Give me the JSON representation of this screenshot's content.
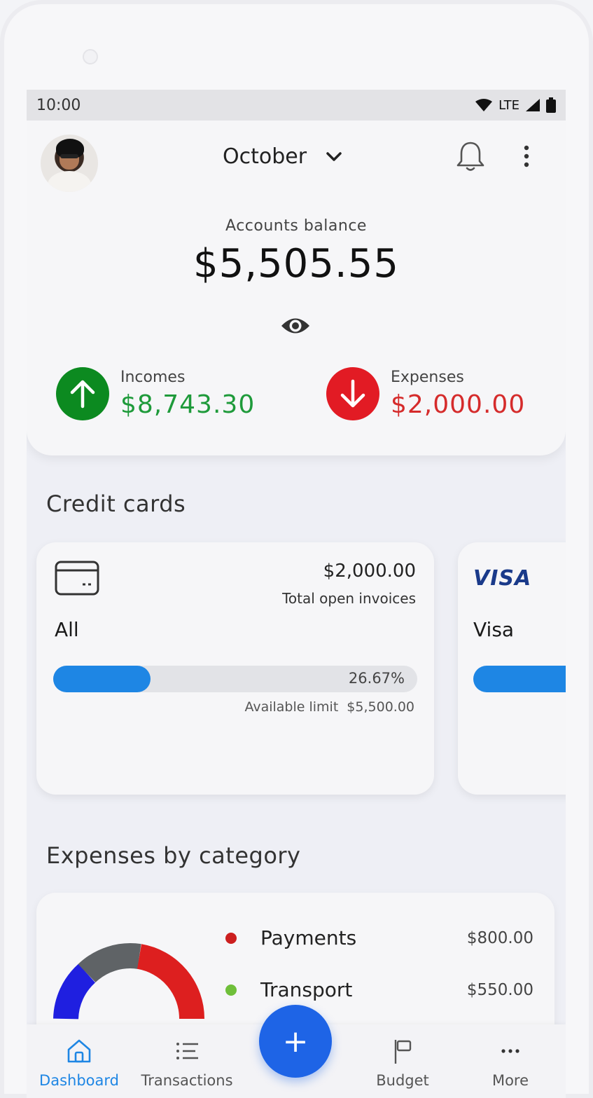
{
  "status_bar": {
    "time": "10:00",
    "network": "LTE"
  },
  "header": {
    "month": "October"
  },
  "balance": {
    "label": "Accounts balance",
    "value": "$5,505.55"
  },
  "incomes": {
    "label": "Incomes",
    "value": "$8,743.30",
    "color": "#1e9a3a"
  },
  "expenses": {
    "label": "Expenses",
    "value": "$2,000.00",
    "color": "#d52b2b"
  },
  "credit_cards": {
    "title": "Credit cards",
    "cards": [
      {
        "name": "All",
        "amount": "$2,000.00",
        "subtitle": "Total open invoices",
        "progress_percent": 26.67,
        "progress_label": "26.67%",
        "available_label": "Available limit",
        "available_value": "$5,500.00"
      },
      {
        "name": "Visa",
        "brand": "VISA"
      }
    ]
  },
  "expenses_by_category": {
    "title": "Expenses by category",
    "items": [
      {
        "name": "Payments",
        "amount": "$800.00",
        "color": "#cc1f1f"
      },
      {
        "name": "Transport",
        "amount": "$550.00",
        "color": "#6fbf3a"
      }
    ],
    "chart_colors": [
      "#1f1fe0",
      "#5f6366",
      "#dd1f1f"
    ]
  },
  "bottom_nav": {
    "items": [
      {
        "label": "Dashboard",
        "active": true
      },
      {
        "label": "Transactions",
        "active": false
      },
      {
        "label": "Budget",
        "active": false
      },
      {
        "label": "More",
        "active": false
      }
    ],
    "fab_label": "+"
  },
  "accent_color": "#1e86e4"
}
